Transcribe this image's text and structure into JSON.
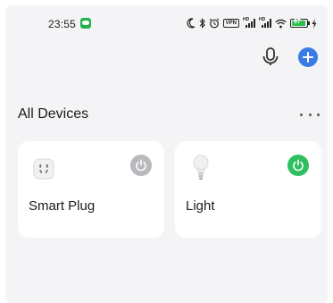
{
  "status_bar": {
    "time": "23:55",
    "vpn_label": "VPN",
    "hd_label": "HD",
    "battery_level": "67"
  },
  "header": {
    "mic_icon": "microphone-icon",
    "add_icon": "plus-icon"
  },
  "section": {
    "title": "All Devices",
    "more_icon": "more-horizontal-icon"
  },
  "devices": [
    {
      "name": "Smart Plug",
      "icon": "smart-plug-icon",
      "power_state": "off",
      "power_color": "#b9b9bd"
    },
    {
      "name": "Light",
      "icon": "light-bulb-icon",
      "power_state": "on",
      "power_color": "#2fbf61"
    }
  ],
  "colors": {
    "accent": "#3b7be6",
    "background": "#f4f4f6",
    "card": "#ffffff"
  }
}
